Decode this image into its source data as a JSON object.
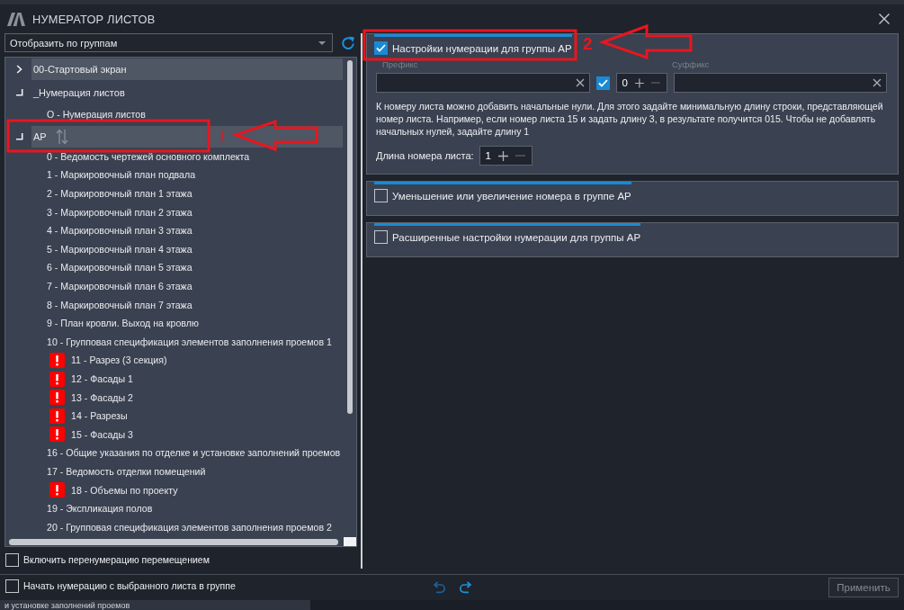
{
  "window": {
    "title": "НУМЕРАТОР ЛИСТОВ"
  },
  "view_select": {
    "value": "Отобразить по группам"
  },
  "tree": [
    {
      "label": "00-Стартовый экран",
      "expanded": false,
      "selected": true,
      "sort_handle": false
    },
    {
      "label": "_Нумерация листов",
      "expanded": true,
      "selected": false,
      "sort_handle": false,
      "children": [
        {
          "label": "O - Нумерация листов",
          "selected": false,
          "warning": false
        }
      ]
    },
    {
      "label": "АР",
      "expanded": true,
      "selected": true,
      "sort_handle": true,
      "children": [
        {
          "label": "0 - Ведомость чертежей основного комплекта",
          "selected": false,
          "warning": false
        },
        {
          "label": "1 - Маркировочный план подвала",
          "selected": false,
          "warning": false
        },
        {
          "label": "2 - Маркировочный план 1 этажа",
          "selected": false,
          "warning": false
        },
        {
          "label": "3 - Маркировочный план 2 этажа",
          "selected": false,
          "warning": false
        },
        {
          "label": "4 - Маркировочный план 3 этажа",
          "selected": false,
          "warning": false
        },
        {
          "label": "5 - Маркировочный план 4 этажа",
          "selected": false,
          "warning": false
        },
        {
          "label": "6 - Маркировочный план 5 этажа",
          "selected": false,
          "warning": false
        },
        {
          "label": "7 - Маркировочный план 6 этажа",
          "selected": false,
          "warning": false
        },
        {
          "label": "8 - Маркировочный план 7 этажа",
          "selected": false,
          "warning": false
        },
        {
          "label": "9 - План кровли. Выход на кровлю",
          "selected": false,
          "warning": false
        },
        {
          "label": "10 - Групповая спецификация элементов заполнения проемов 1",
          "selected": false,
          "warning": false
        },
        {
          "label": "11 - Разрез (3 секция)",
          "selected": false,
          "warning": true
        },
        {
          "label": "12 - Фасады 1",
          "selected": false,
          "warning": true
        },
        {
          "label": "13 - Фасады 2",
          "selected": false,
          "warning": true
        },
        {
          "label": "14 - Разрезы",
          "selected": false,
          "warning": true
        },
        {
          "label": "15 - Фасады 3",
          "selected": false,
          "warning": true
        },
        {
          "label": "16 - Общие указания по отделке и установке заполнений проемов",
          "selected": false,
          "warning": false
        },
        {
          "label": "17 - Ведомость отделки помещений",
          "selected": false,
          "warning": false
        },
        {
          "label": "18 - Объемы по проекту",
          "selected": false,
          "warning": true
        },
        {
          "label": "19 - Экспликация полов",
          "selected": false,
          "warning": false
        },
        {
          "label": "20 - Групповая спецификация элементов заполнения проемов 2",
          "selected": false,
          "warning": false
        }
      ]
    }
  ],
  "move_renumber": {
    "label": "Включить перенумерацию перемещением",
    "checked": false
  },
  "numbering_group": {
    "label": "Настройки нумерации для группы АР",
    "checked": true,
    "prefix_label": "Префикс",
    "suffix_label": "Суффикс",
    "padding_checkbox": {
      "checked": true
    },
    "padding_spinner": {
      "value": "0",
      "decrease_disabled": true
    },
    "hint": "К номеру листа можно добавить начальные нули. Для этого задайте минимальную длину строки, представляющей номер листа. Например, если номер листа 15 и задать длину 3, в результате получится 015. Чтобы не добавлять начальных нулей, задайте длину 1",
    "length": {
      "label": "Длина номера листа:",
      "value": "1",
      "decrease_disabled": true
    }
  },
  "option_groups": [
    {
      "label": "Уменьшение или увеличение номера в группе АР",
      "checked": false
    },
    {
      "label": "Расширенные настройки нумерации для группы АР",
      "checked": false
    }
  ],
  "start_from_selected": {
    "label": "Начать нумерацию с выбранного листа в группе",
    "checked": false
  },
  "undo": {
    "disabled": true
  },
  "redo": {
    "disabled": false
  },
  "apply_button": {
    "label": "Применить",
    "disabled": true
  },
  "annotations": [
    {
      "number": "1"
    },
    {
      "number": "2"
    }
  ],
  "background_window": {
    "text": "и установке заполнений проемов"
  }
}
